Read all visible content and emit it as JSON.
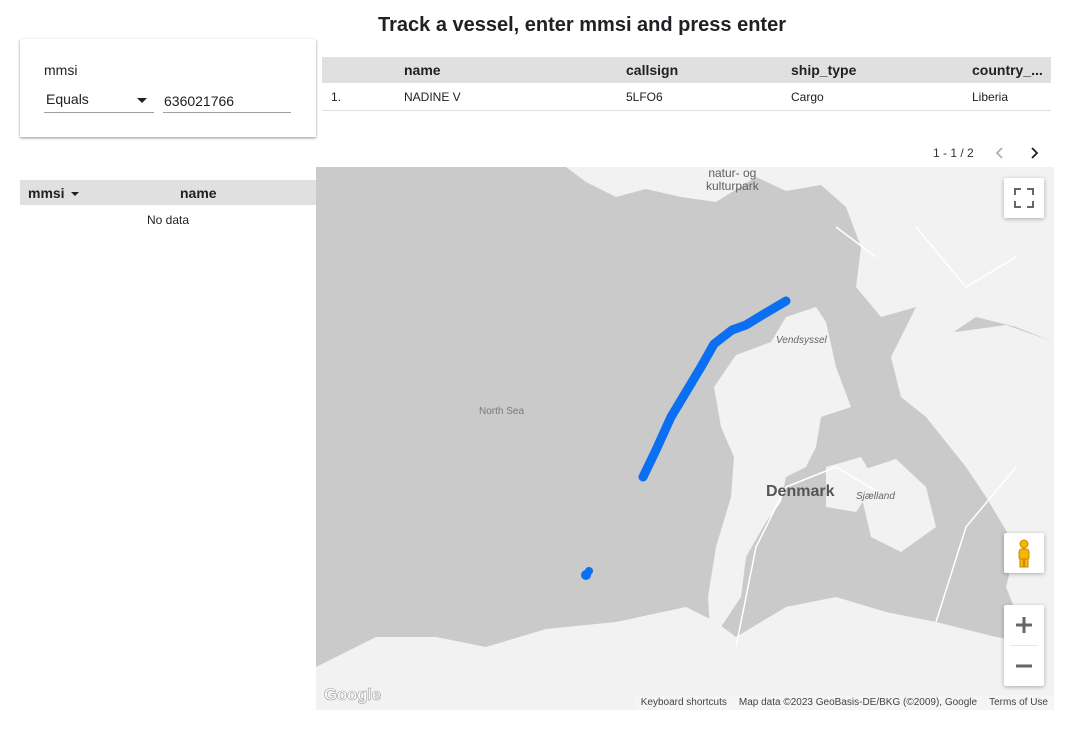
{
  "page": {
    "title": "Track a vessel, enter mmsi and press enter"
  },
  "filter": {
    "label": "mmsi",
    "operator": "Equals",
    "value": "636021766"
  },
  "vessel_table": {
    "columns": [
      "",
      "name",
      "callsign",
      "ship_type",
      "country_..."
    ],
    "rows": [
      {
        "index": "1.",
        "name": "NADINE V",
        "callsign": "5LFO6",
        "ship_type": "Cargo",
        "country": "Liberia"
      }
    ]
  },
  "pagination": {
    "range": "1 - 1 / 2"
  },
  "track_table": {
    "columns": [
      "mmsi",
      "name"
    ],
    "sorted_by": "mmsi",
    "empty_text": "No data"
  },
  "map": {
    "labels": {
      "natur": "natur- og\nkulturpark",
      "vendsyssel": "Vendsyssel",
      "north_sea": "North Sea",
      "denmark": "Denmark",
      "sjaelland": "Sjælland"
    },
    "logo": "Google",
    "attribution": {
      "shortcuts": "Keyboard shortcuts",
      "mapdata": "Map data ©2023 GeoBasis-DE/BKG (©2009), Google",
      "terms": "Terms of Use"
    },
    "track_color": "#0b6ff2",
    "land_color": "#f2f2f2",
    "water_color": "#cacaca",
    "controls": [
      "fullscreen-icon",
      "pegman-icon",
      "zoom-in-icon",
      "zoom-out-icon"
    ]
  }
}
